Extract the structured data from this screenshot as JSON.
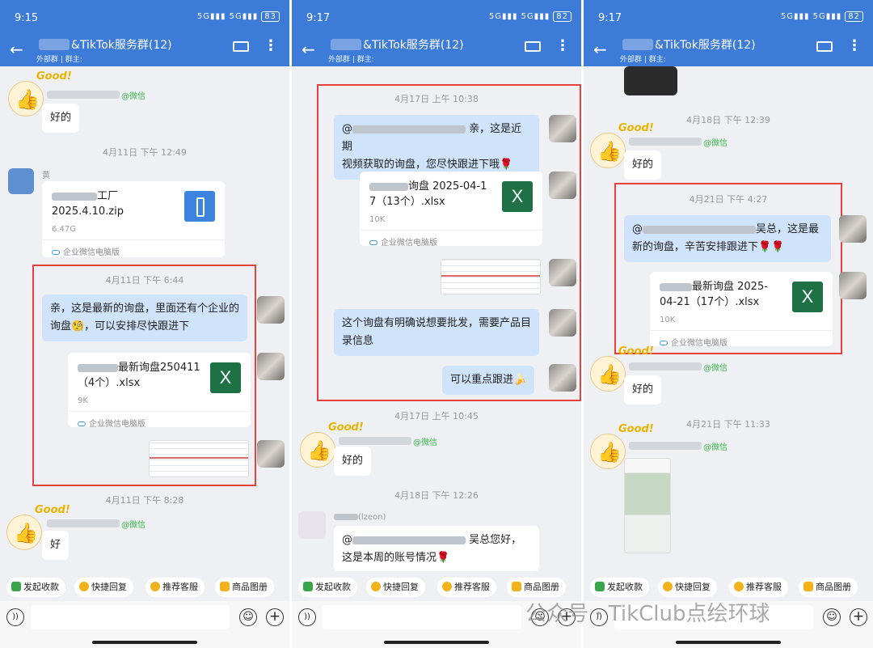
{
  "header": {
    "group_name": "&TikTok服务群(12)",
    "external_tag": "外部群",
    "owner_label": "群主:"
  },
  "status_times": [
    "9:15",
    "9:17",
    "9:17"
  ],
  "battery": [
    "83",
    "82",
    "82"
  ],
  "quick_actions": [
    "发起收款",
    "快捷回复",
    "推荐客服",
    "商品图册"
  ],
  "wechat_tag": "@微信",
  "file_footer": "企业微信电脑版",
  "panel1": {
    "reply1": "好的",
    "ts1": "4月11日  下午 12:49",
    "sender_initial": "黄",
    "zip_name_1": "工厂",
    "zip_name_2": "2025.4.10.zip",
    "zip_size": "6.47G",
    "ts2": "4月11日  下午 6:44",
    "msg": "亲，这是最新的询盘，里面还有个企业的询盘🧐，可以安排尽快跟进下",
    "file_name_1": "最新询盘250411",
    "file_name_2": "（4个）.xlsx",
    "file_size": "9K",
    "ts3": "4月11日  下午 8:28",
    "reply2": "好"
  },
  "panel2": {
    "ts1": "4月17日  上午 10:38",
    "msg1_tail": "亲，这是近期",
    "msg1_line2": "视频获取的询盘，您尽快跟进下哦🌹",
    "file_name_1": "询盘 2025-04-1",
    "file_name_2": "7（13个）.xlsx",
    "file_size": "10K",
    "msg2": "这个询盘有明确说想要批发，需要产品目录信息",
    "msg3": "可以重点跟进🍌",
    "ts2": "4月17日  上午 10:45",
    "reply1": "好的",
    "ts3": "4月18日  下午 12:26",
    "sender": "(lzeon)",
    "msg4_tail": "吴总您好，",
    "msg4_line2": "这是本周的账号情况🌹"
  },
  "panel3": {
    "ts1": "4月18日  下午 12:39",
    "reply1": "好的",
    "ts2": "4月21日  下午 4:27",
    "msg1_tail": "吴总，这是最",
    "msg1_line2": "新的询盘，辛苦安排跟进下🌹🌹",
    "file_name_1": "最新询盘  2025-",
    "file_name_2": "04-21（17个）.xlsx",
    "file_size": "10K",
    "reply2": "好的",
    "ts3": "4月21日  下午 11:33"
  },
  "watermark": "公众号 · TikClub点绘环球",
  "colors": {
    "header_blue": "#3d7bd8",
    "bubble_blue": "#cfe3fb",
    "highlight_red": "#e64040",
    "wechat_green": "#39b54a",
    "excel_green": "#1e7145"
  }
}
